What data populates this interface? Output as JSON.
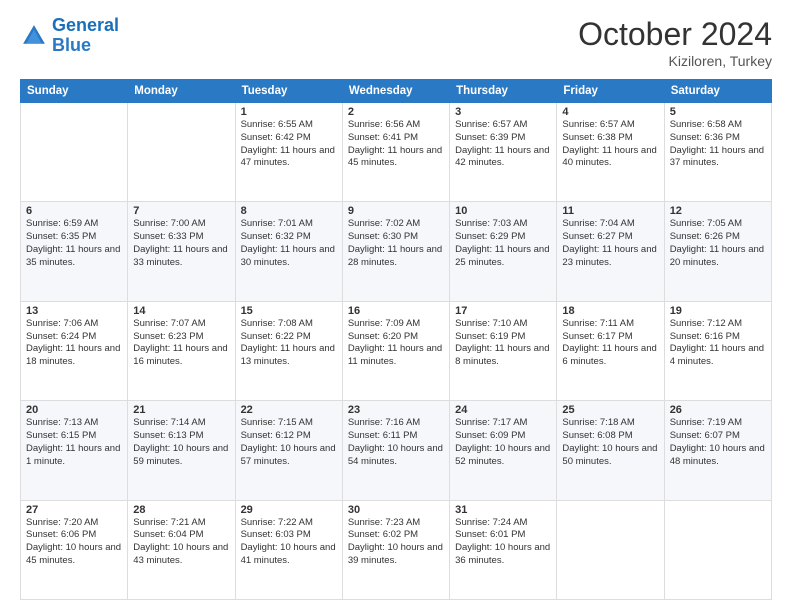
{
  "header": {
    "logo_line1": "General",
    "logo_line2": "Blue",
    "month": "October 2024",
    "location": "Kiziloren, Turkey"
  },
  "days_of_week": [
    "Sunday",
    "Monday",
    "Tuesday",
    "Wednesday",
    "Thursday",
    "Friday",
    "Saturday"
  ],
  "weeks": [
    [
      {
        "day": "",
        "lines": []
      },
      {
        "day": "",
        "lines": []
      },
      {
        "day": "1",
        "lines": [
          "Sunrise: 6:55 AM",
          "Sunset: 6:42 PM",
          "Daylight: 11 hours and 47 minutes."
        ]
      },
      {
        "day": "2",
        "lines": [
          "Sunrise: 6:56 AM",
          "Sunset: 6:41 PM",
          "Daylight: 11 hours and 45 minutes."
        ]
      },
      {
        "day": "3",
        "lines": [
          "Sunrise: 6:57 AM",
          "Sunset: 6:39 PM",
          "Daylight: 11 hours and 42 minutes."
        ]
      },
      {
        "day": "4",
        "lines": [
          "Sunrise: 6:57 AM",
          "Sunset: 6:38 PM",
          "Daylight: 11 hours and 40 minutes."
        ]
      },
      {
        "day": "5",
        "lines": [
          "Sunrise: 6:58 AM",
          "Sunset: 6:36 PM",
          "Daylight: 11 hours and 37 minutes."
        ]
      }
    ],
    [
      {
        "day": "6",
        "lines": [
          "Sunrise: 6:59 AM",
          "Sunset: 6:35 PM",
          "Daylight: 11 hours and 35 minutes."
        ]
      },
      {
        "day": "7",
        "lines": [
          "Sunrise: 7:00 AM",
          "Sunset: 6:33 PM",
          "Daylight: 11 hours and 33 minutes."
        ]
      },
      {
        "day": "8",
        "lines": [
          "Sunrise: 7:01 AM",
          "Sunset: 6:32 PM",
          "Daylight: 11 hours and 30 minutes."
        ]
      },
      {
        "day": "9",
        "lines": [
          "Sunrise: 7:02 AM",
          "Sunset: 6:30 PM",
          "Daylight: 11 hours and 28 minutes."
        ]
      },
      {
        "day": "10",
        "lines": [
          "Sunrise: 7:03 AM",
          "Sunset: 6:29 PM",
          "Daylight: 11 hours and 25 minutes."
        ]
      },
      {
        "day": "11",
        "lines": [
          "Sunrise: 7:04 AM",
          "Sunset: 6:27 PM",
          "Daylight: 11 hours and 23 minutes."
        ]
      },
      {
        "day": "12",
        "lines": [
          "Sunrise: 7:05 AM",
          "Sunset: 6:26 PM",
          "Daylight: 11 hours and 20 minutes."
        ]
      }
    ],
    [
      {
        "day": "13",
        "lines": [
          "Sunrise: 7:06 AM",
          "Sunset: 6:24 PM",
          "Daylight: 11 hours and 18 minutes."
        ]
      },
      {
        "day": "14",
        "lines": [
          "Sunrise: 7:07 AM",
          "Sunset: 6:23 PM",
          "Daylight: 11 hours and 16 minutes."
        ]
      },
      {
        "day": "15",
        "lines": [
          "Sunrise: 7:08 AM",
          "Sunset: 6:22 PM",
          "Daylight: 11 hours and 13 minutes."
        ]
      },
      {
        "day": "16",
        "lines": [
          "Sunrise: 7:09 AM",
          "Sunset: 6:20 PM",
          "Daylight: 11 hours and 11 minutes."
        ]
      },
      {
        "day": "17",
        "lines": [
          "Sunrise: 7:10 AM",
          "Sunset: 6:19 PM",
          "Daylight: 11 hours and 8 minutes."
        ]
      },
      {
        "day": "18",
        "lines": [
          "Sunrise: 7:11 AM",
          "Sunset: 6:17 PM",
          "Daylight: 11 hours and 6 minutes."
        ]
      },
      {
        "day": "19",
        "lines": [
          "Sunrise: 7:12 AM",
          "Sunset: 6:16 PM",
          "Daylight: 11 hours and 4 minutes."
        ]
      }
    ],
    [
      {
        "day": "20",
        "lines": [
          "Sunrise: 7:13 AM",
          "Sunset: 6:15 PM",
          "Daylight: 11 hours and 1 minute."
        ]
      },
      {
        "day": "21",
        "lines": [
          "Sunrise: 7:14 AM",
          "Sunset: 6:13 PM",
          "Daylight: 10 hours and 59 minutes."
        ]
      },
      {
        "day": "22",
        "lines": [
          "Sunrise: 7:15 AM",
          "Sunset: 6:12 PM",
          "Daylight: 10 hours and 57 minutes."
        ]
      },
      {
        "day": "23",
        "lines": [
          "Sunrise: 7:16 AM",
          "Sunset: 6:11 PM",
          "Daylight: 10 hours and 54 minutes."
        ]
      },
      {
        "day": "24",
        "lines": [
          "Sunrise: 7:17 AM",
          "Sunset: 6:09 PM",
          "Daylight: 10 hours and 52 minutes."
        ]
      },
      {
        "day": "25",
        "lines": [
          "Sunrise: 7:18 AM",
          "Sunset: 6:08 PM",
          "Daylight: 10 hours and 50 minutes."
        ]
      },
      {
        "day": "26",
        "lines": [
          "Sunrise: 7:19 AM",
          "Sunset: 6:07 PM",
          "Daylight: 10 hours and 48 minutes."
        ]
      }
    ],
    [
      {
        "day": "27",
        "lines": [
          "Sunrise: 7:20 AM",
          "Sunset: 6:06 PM",
          "Daylight: 10 hours and 45 minutes."
        ]
      },
      {
        "day": "28",
        "lines": [
          "Sunrise: 7:21 AM",
          "Sunset: 6:04 PM",
          "Daylight: 10 hours and 43 minutes."
        ]
      },
      {
        "day": "29",
        "lines": [
          "Sunrise: 7:22 AM",
          "Sunset: 6:03 PM",
          "Daylight: 10 hours and 41 minutes."
        ]
      },
      {
        "day": "30",
        "lines": [
          "Sunrise: 7:23 AM",
          "Sunset: 6:02 PM",
          "Daylight: 10 hours and 39 minutes."
        ]
      },
      {
        "day": "31",
        "lines": [
          "Sunrise: 7:24 AM",
          "Sunset: 6:01 PM",
          "Daylight: 10 hours and 36 minutes."
        ]
      },
      {
        "day": "",
        "lines": []
      },
      {
        "day": "",
        "lines": []
      }
    ]
  ]
}
